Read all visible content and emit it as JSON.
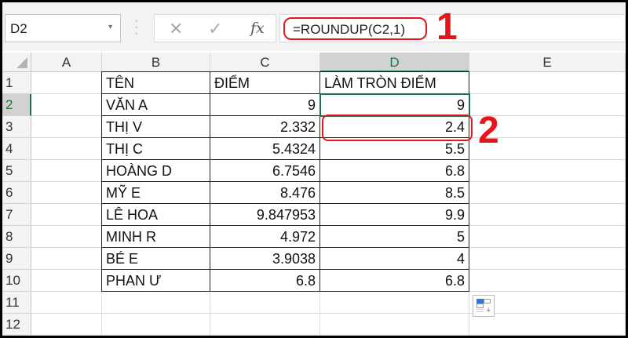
{
  "name_box": "D2",
  "formula_bar": {
    "cancel_icon": "✕",
    "enter_icon": "✓",
    "fx_label": "fx",
    "formula": "=ROUNDUP(C2,1)"
  },
  "annotations": [
    "1",
    "2"
  ],
  "columns": [
    "A",
    "B",
    "C",
    "D",
    "E"
  ],
  "rows": [
    "1",
    "2",
    "3",
    "4",
    "5",
    "6",
    "7",
    "8",
    "9",
    "10",
    "11",
    "12"
  ],
  "headers": {
    "b": "TÊN",
    "c": "ĐIỂM",
    "d": "LÀM TRÒN ĐIỂM"
  },
  "data": [
    {
      "name": "VĂN A",
      "score": "9",
      "rounded": "9"
    },
    {
      "name": "THỊ V",
      "score": "2.332",
      "rounded": "2.4"
    },
    {
      "name": "THỊ C",
      "score": "5.4324",
      "rounded": "5.5"
    },
    {
      "name": "HOÀNG D",
      "score": "6.7546",
      "rounded": "6.8"
    },
    {
      "name": "MỸ E",
      "score": "8.476",
      "rounded": "8.5"
    },
    {
      "name": "LÊ HOA",
      "score": "9.847953",
      "rounded": "9.9"
    },
    {
      "name": "MINH R",
      "score": "4.972",
      "rounded": "5"
    },
    {
      "name": "BÉ E",
      "score": "3.9038",
      "rounded": "4"
    },
    {
      "name": "PHAN Ư",
      "score": "6.8",
      "rounded": "6.8"
    }
  ],
  "colors": {
    "accent": "#217346",
    "annotation": "#e8141b"
  }
}
